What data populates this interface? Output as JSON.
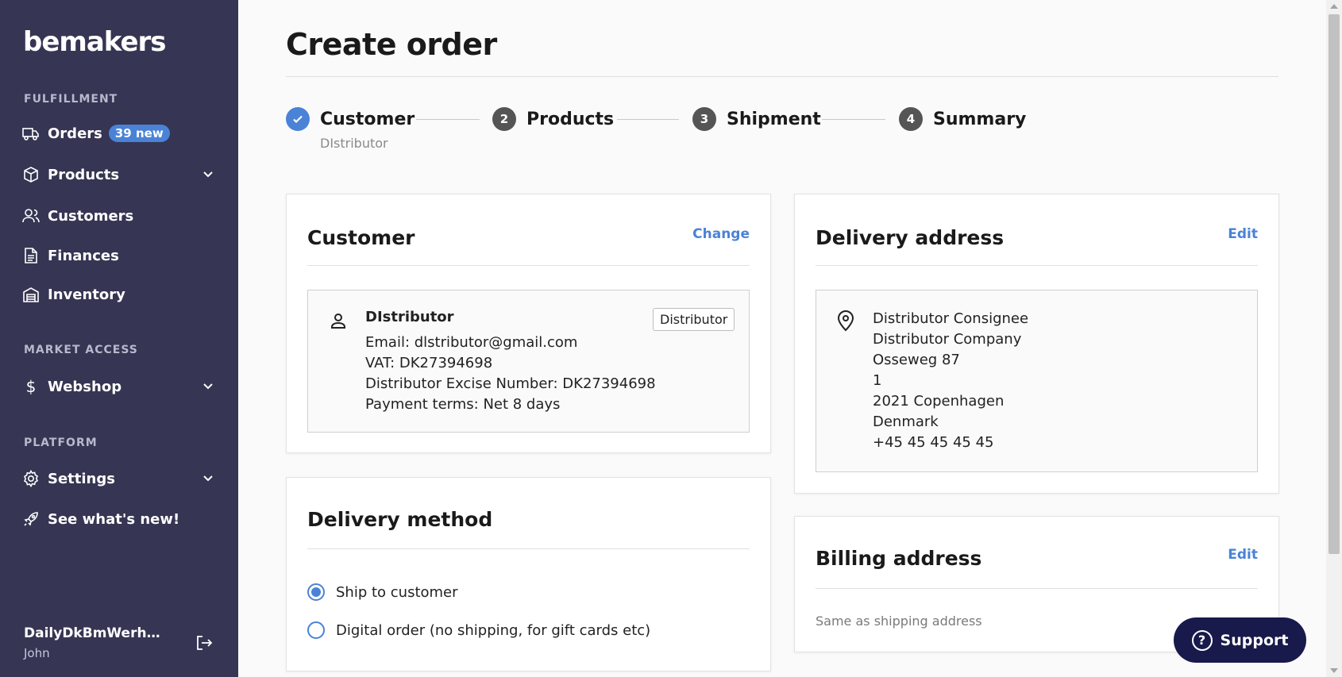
{
  "sidebar": {
    "logo": "bemakers",
    "sections": {
      "fulfillment": "FULFILLMENT",
      "market_access": "MARKET ACCESS",
      "platform": "PLATFORM"
    },
    "items": {
      "orders": {
        "label": "Orders",
        "icon": "truck-icon",
        "badge": "39 new"
      },
      "products": {
        "label": "Products",
        "icon": "box-icon"
      },
      "customers": {
        "label": "Customers",
        "icon": "users-icon"
      },
      "finances": {
        "label": "Finances",
        "icon": "document-icon"
      },
      "inventory": {
        "label": "Inventory",
        "icon": "warehouse-icon"
      },
      "webshop": {
        "label": "Webshop",
        "icon": "dollar-icon"
      },
      "settings": {
        "label": "Settings",
        "icon": "gear-icon"
      },
      "whats_new": {
        "label": "See what's new!",
        "icon": "rocket-icon"
      }
    },
    "user": {
      "name": "DailyDkBmWerhau...",
      "sub": "John"
    }
  },
  "page": {
    "title": "Create order"
  },
  "stepper": {
    "steps": [
      {
        "label": "Customer",
        "number": "",
        "done": true,
        "sub": "DIstributor"
      },
      {
        "label": "Products",
        "number": "2"
      },
      {
        "label": "Shipment",
        "number": "3"
      },
      {
        "label": "Summary",
        "number": "4"
      }
    ]
  },
  "customer_card": {
    "title": "Customer",
    "action": "Change",
    "name": "DIstributor",
    "tag": "Distributor",
    "lines": [
      "Email: dlstributor@gmail.com",
      "VAT: DK27394698",
      "Distributor Excise Number: DK27394698",
      "Payment terms: Net 8 days"
    ]
  },
  "delivery_address_card": {
    "title": "Delivery address",
    "action": "Edit",
    "lines": [
      "Distributor Consignee",
      "Distributor Company",
      "Osseweg 87",
      "1",
      "2021 Copenhagen",
      "Denmark",
      "+45 45 45 45 45"
    ]
  },
  "delivery_method_card": {
    "title": "Delivery method",
    "options": [
      {
        "label": "Ship to customer",
        "selected": true
      },
      {
        "label": "Digital order (no shipping, for gift cards etc)",
        "selected": false
      }
    ]
  },
  "billing_address_card": {
    "title": "Billing address",
    "action": "Edit",
    "note": "Same as shipping address"
  },
  "support": {
    "label": "Support"
  },
  "colors": {
    "sidebar_bg": "#363553",
    "accent": "#4a83d6",
    "support_bg": "#171a4a"
  }
}
